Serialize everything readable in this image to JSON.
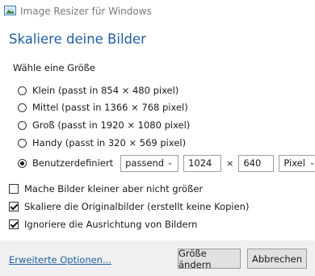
{
  "window": {
    "title": "Image Resizer für Windows",
    "icon": "image-resizer-app-icon"
  },
  "heading": "Skaliere deine Bilder",
  "size_group": {
    "label": "Wähle eine Größe",
    "options": [
      {
        "label": "Klein (passt in 854 × 480 pixel)",
        "checked": false
      },
      {
        "label": "Mittel (passt in 1366 × 768 pixel)",
        "checked": false
      },
      {
        "label": "Groß (passt in 1920 × 1080 pixel)",
        "checked": false
      },
      {
        "label": "Handy (passt in 320 × 569 pixel)",
        "checked": false
      }
    ],
    "custom": {
      "label": "Benutzerdefiniert",
      "checked": true,
      "fit_mode": "passend",
      "width": "1024",
      "times": "×",
      "height": "640",
      "unit": "Pixel"
    }
  },
  "checkboxes": [
    {
      "label": "Mache Bilder kleiner aber nicht größer",
      "checked": false
    },
    {
      "label": "Skaliere die Originalbilder (erstellt keine Kopien)",
      "checked": true
    },
    {
      "label": "Ignoriere die Ausrichtung von Bildern",
      "checked": true
    }
  ],
  "footer": {
    "advanced_link": "Erweiterte Optionen...",
    "resize_button": "Größe ändern",
    "cancel_button": "Abbrechen"
  }
}
